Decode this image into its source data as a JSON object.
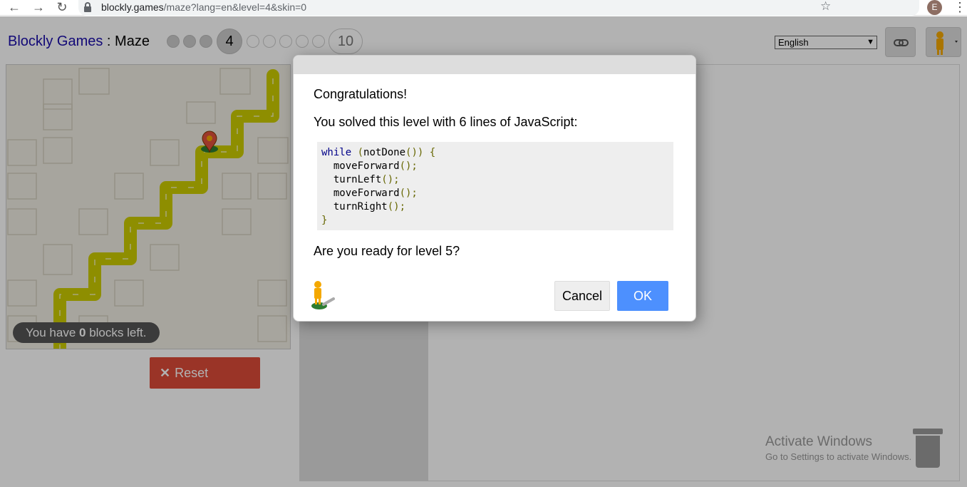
{
  "browser": {
    "url_host": "blockly.games",
    "url_path": "/maze?lang=en&level=4&skin=0",
    "profile_initial": "E"
  },
  "header": {
    "app_link": "Blockly Games",
    "separator": " : ",
    "page_name": "Maze",
    "current_level": "4",
    "max_level": "10",
    "language": "English"
  },
  "maze": {
    "blocks_left_prefix": "You have ",
    "blocks_left_count": "0",
    "blocks_left_suffix": " blocks left.",
    "reset_label": "Reset"
  },
  "watermark": {
    "line1": "Activate Windows",
    "line2": "Go to Settings to activate Windows."
  },
  "dialog": {
    "congrats": "Congratulations!",
    "solved": "You solved this level with 6 lines of JavaScript:",
    "code_lines": [
      "while (notDone()) {",
      "  moveForward();",
      "  turnLeft();",
      "  moveForward();",
      "  turnRight();",
      "}"
    ],
    "ready": "Are you ready for level 5?",
    "cancel_label": "Cancel",
    "ok_label": "OK"
  },
  "colors": {
    "path": "#cccc00",
    "reset": "#dd4b39",
    "ok": "#4d90fe",
    "link": "#1a0dab"
  }
}
